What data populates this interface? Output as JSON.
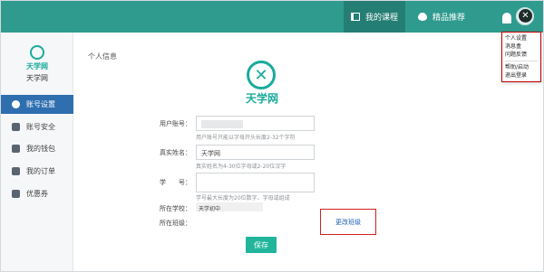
{
  "colors": {
    "topbar": "#2f9b8f",
    "accent": "#1aaa9b",
    "sidebar_active": "#2f6fb0",
    "save_button": "#22b59c",
    "highlight": "#d32020"
  },
  "top_tabs": [
    {
      "label": "我的课程",
      "icon": "book-icon"
    },
    {
      "label": "精品推荐",
      "icon": "flame-icon"
    }
  ],
  "user_menu": [
    "个人设置",
    "消息盒",
    "问题反馈",
    "帮助/启动",
    "退出登录"
  ],
  "sidebar": {
    "logo_text": "天学网",
    "site_name": "天学网",
    "items": [
      {
        "label": "账号设置",
        "icon": "gear-icon"
      },
      {
        "label": "账号安全",
        "icon": "shield-icon"
      },
      {
        "label": "我的钱包",
        "icon": "wallet-icon"
      },
      {
        "label": "我的订单",
        "icon": "order-icon"
      },
      {
        "label": "优惠券",
        "icon": "coupon-icon"
      }
    ]
  },
  "main": {
    "section_title": "个人信息",
    "brand_text": "天学网",
    "username_label": "用户账号：",
    "username_hint": "用户账号只能以字母开头长度2-32个字符",
    "realname_label": "真实姓名：",
    "realname_value": "天学网",
    "realname_hint": "真实姓名为4-30位字母或2-20位汉字",
    "studentno_label": "学　　号：",
    "studentno_hint": "学号最大长度为20位数字、字母或组成",
    "school_label": "所在学校：",
    "school_value": "天学初中",
    "class_label": "所在班级：",
    "change_class_link": "更改班级",
    "save_label": "保存"
  }
}
